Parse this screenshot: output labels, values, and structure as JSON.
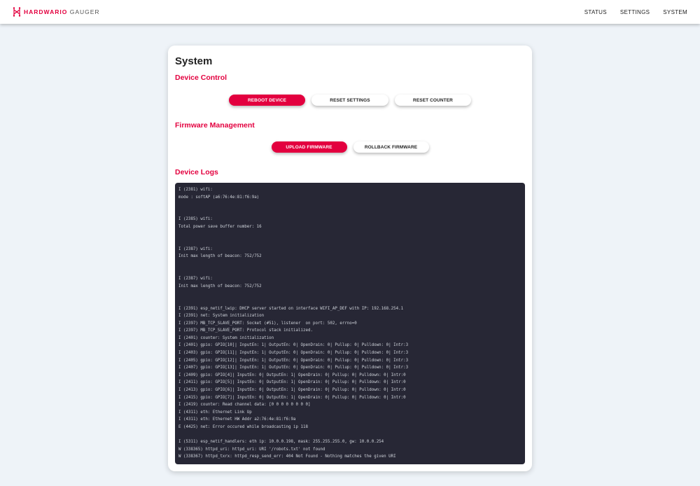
{
  "header": {
    "brand_name": "HARDWARIO",
    "brand_product": "GAUGER",
    "nav": [
      {
        "label": "STATUS"
      },
      {
        "label": "SETTINGS"
      },
      {
        "label": "SYSTEM"
      }
    ]
  },
  "page": {
    "title": "System",
    "device_control": {
      "title": "Device Control",
      "reboot_label": "REBOOT DEVICE",
      "reset_settings_label": "RESET SETTINGS",
      "reset_counter_label": "RESET COUNTER"
    },
    "firmware": {
      "title": "Firmware Management",
      "upload_label": "UPLOAD FIRMWARE",
      "rollback_label": "ROLLBACK FIRMWARE"
    },
    "logs": {
      "title": "Device Logs",
      "text": "I (2381) wifi:\nmode : softAP (a6:76:4e:81:f6:9a)\n\n\nI (2385) wifi:\nTotal power save buffer number: 16\n\n\nI (2387) wifi:\nInit max length of beacon: 752/752\n\n\nI (2387) wifi:\nInit max length of beacon: 752/752\n\n\nI (2391) esp_netif_lwip: DHCP server started on interface WIFI_AP_DEF with IP: 192.168.254.1\nI (2391) net: System initialization\nI (2397) MB_TCP_SLAVE_PORT: Socket (#51), listener  on port: 502, errno=0\nI (2397) MB_TCP_SLAVE_PORT: Protocol stack initialized.\nI (2401) counter: System initialization\nI (2401) gpio: GPIO[10]| InputEn: 1| OutputEn: 0| OpenDrain: 0| Pullup: 0| Pulldown: 0| Intr:3\nI (2403) gpio: GPIO[11]| InputEn: 1| OutputEn: 0| OpenDrain: 0| Pullup: 0| Pulldown: 0| Intr:3\nI (2405) gpio: GPIO[12]| InputEn: 1| OutputEn: 0| OpenDrain: 0| Pullup: 0| Pulldown: 0| Intr:3\nI (2407) gpio: GPIO[13]| InputEn: 1| OutputEn: 0| OpenDrain: 0| Pullup: 0| Pulldown: 0| Intr:3\nI (2409) gpio: GPIO[4]| InputEn: 0| OutputEn: 1| OpenDrain: 0| Pullup: 0| Pulldown: 0| Intr:0\nI (2411) gpio: GPIO[5]| InputEn: 0| OutputEn: 1| OpenDrain: 0| Pullup: 0| Pulldown: 0| Intr:0\nI (2413) gpio: GPIO[6]| InputEn: 0| OutputEn: 1| OpenDrain: 0| Pullup: 0| Pulldown: 0| Intr:0\nI (2415) gpio: GPIO[7]| InputEn: 0| OutputEn: 1| OpenDrain: 0| Pullup: 0| Pulldown: 0| Intr:0\nI (2419) counter: Read channel data: [0 0 0 0 0 0 0 0]\nI (4311) eth: Ethernet Link Up\nI (4311) eth: Ethernet HW Addr a2:76:4e:81:f6:9a\nE (4425) net: Error occured while broadcasting ip 118\n\nI (5311) esp_netif_handlers: eth ip: 10.0.0.198, mask: 255.255.255.0, gw: 10.0.0.254\nW (338365) httpd_uri: httpd_uri: URI '/robots.txt' not found\nW (338367) httpd_txrx: httpd_resp_send_err: 404 Not Found - Nothing matches the given URI"
    }
  },
  "colors": {
    "accent": "#e3003f",
    "background": "#eef3f8",
    "log_background": "#272735"
  }
}
